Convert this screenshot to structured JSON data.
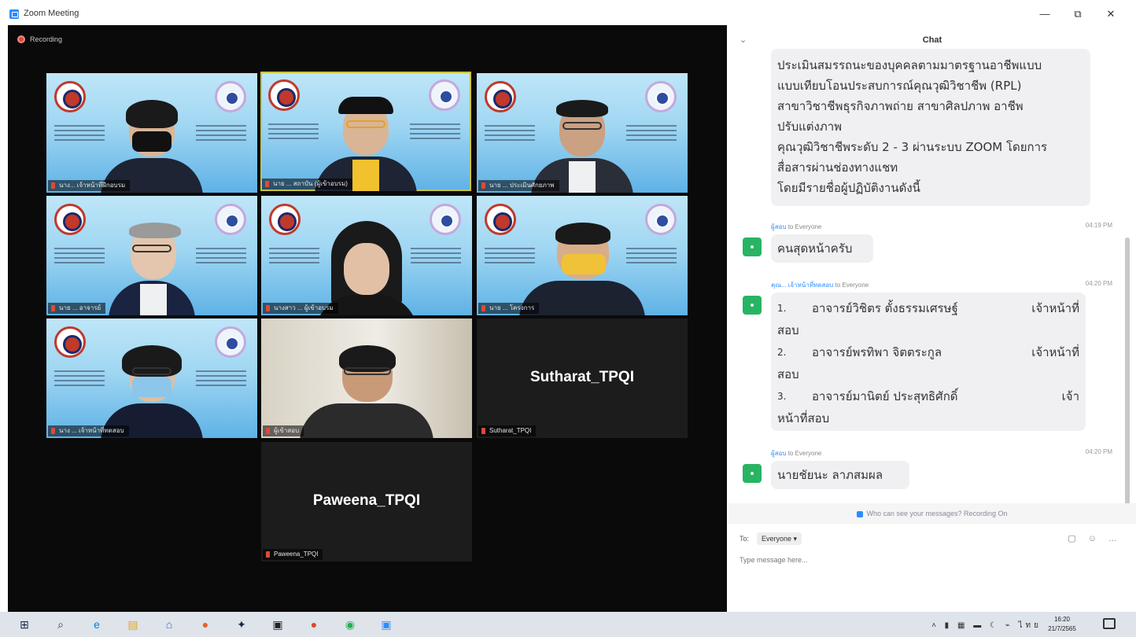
{
  "window": {
    "title": "Zoom Meeting",
    "minimize": "—",
    "restore": "⧉",
    "close": "✕"
  },
  "recording_label": "Recording",
  "tiles": [
    {
      "name": "นาง... เจ้าหน้าที่ฝึกอบรม"
    },
    {
      "name": "นาย ... สถาบัน (ผู้เข้าอบรม)"
    },
    {
      "name": "นาย ... ประเมินศักยภาพ"
    },
    {
      "name": "นาย ... อาจารย์"
    },
    {
      "name": "นางสาว ... ผู้เข้าอบรม"
    },
    {
      "name": "นาย ... โครงการ"
    },
    {
      "name": "นาง ... เจ้าหน้าที่ทดสอบ"
    },
    {
      "name": "ผู้เข้าสอบ"
    },
    {
      "big_name": "Sutharat_TPQI",
      "name": "Sutharat_TPQI"
    },
    {
      "big_name": "Paweena_TPQI",
      "name": "Paweena_TPQI"
    }
  ],
  "chat": {
    "title": "Chat",
    "collapse_icon": "⌄",
    "first_message": [
      "ประเมินสมรรถนะของบุคคลตามมาตรฐานอาชีพแบบ",
      "แบบเทียบโอนประสบการณ์คุณวุฒิวิชาชีพ (RPL)",
      "สาขาวิชาชีพธุรกิจภาพถ่าย สาขาศิลปภาพ อาชีพ",
      "ปรับแต่งภาพ",
      "คุณวุฒิวิชาชีพระดับ 2 - 3 ผ่านระบบ ZOOM โดยการ",
      "สื่อสารผ่านช่องทางแชท",
      "โดยมีรายชื่อผู้ปฏิบัติงานดังนี้"
    ],
    "msg2": {
      "sender": "ผู้สอบ",
      "to": "to Everyone",
      "time": "04:19 PM",
      "text": "คนสุดหน้าครับ"
    },
    "msg3": {
      "sender": "คุณ... เจ้าหน้าที่ทดสอบ",
      "to": "to Everyone",
      "time": "04:20 PM",
      "items": [
        {
          "num": "1.",
          "name": "อาจารย์วิชิตร ตั้งธรรมเศรษฐ์",
          "role": "เจ้าหน้าที่",
          "role2": "สอบ"
        },
        {
          "num": "2.",
          "name": "อาจารย์พรทิพา จิตตระกูล",
          "role": "เจ้าหน้าที่",
          "role2": "สอบ"
        },
        {
          "num": "3.",
          "name": "อาจารย์มานิตย์ ประสุทธิศักดิ์",
          "role": "เจ้า",
          "role2": "หน้าที่สอบ"
        }
      ]
    },
    "msg4": {
      "sender": "ผู้สอบ",
      "to": "to Everyone",
      "time": "04:20 PM",
      "text": "นายชัยนะ ลาภสมผล"
    },
    "privacy_notice": "Who can see your messages? Recording On",
    "to_label": "To:",
    "to_value": "Everyone ▾",
    "input_placeholder": "Type message here...",
    "input_icons": "▢ ☺ …"
  },
  "taskbar": {
    "icons": [
      {
        "glyph": "⊞",
        "color": "#1f2a44"
      },
      {
        "glyph": "⌕",
        "color": "#333333"
      },
      {
        "glyph": "e",
        "color": "#0a7bd7"
      },
      {
        "glyph": "▤",
        "color": "#e8a317"
      },
      {
        "glyph": "⌂",
        "color": "#2b6fd6"
      },
      {
        "glyph": "●",
        "color": "#e8602c"
      },
      {
        "glyph": "✦",
        "color": "#1a2a4a"
      },
      {
        "glyph": "▣",
        "color": "#222222"
      },
      {
        "glyph": "●",
        "color": "#d74a2a"
      },
      {
        "glyph": "◉",
        "color": "#23b14d"
      },
      {
        "glyph": "▣",
        "color": "#2d8cff"
      }
    ],
    "tray": "˄ ▮ ▦ ▬ ☾ ⌁ ไทย",
    "time": "16:20",
    "date": "21/7/2565"
  },
  "colors": {
    "accent": "#2d8cff",
    "record": "#e0483b",
    "active_speaker": "#c9c33a",
    "chat_avatar": "#28b463"
  }
}
